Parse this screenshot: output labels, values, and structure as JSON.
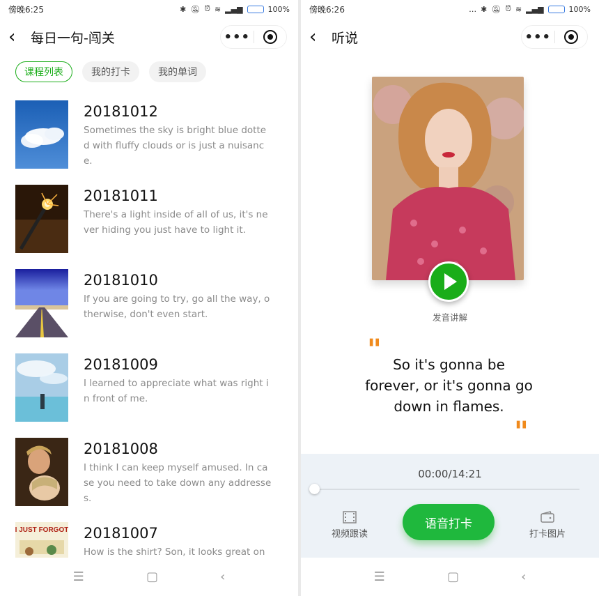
{
  "left": {
    "status": {
      "time": "傍晚6:25",
      "battery": "100%"
    },
    "nav": {
      "title": "每日一句-闯关"
    },
    "tabs": [
      {
        "label": "课程列表",
        "active": true
      },
      {
        "label": "我的打卡",
        "active": false
      },
      {
        "label": "我的单词",
        "active": false
      }
    ],
    "lessons": [
      {
        "date": "20181012",
        "text": "Sometimes the sky is bright blue dotted with fluffy clouds or is just a nuisance."
      },
      {
        "date": "20181011",
        "text": "There's a light inside of all of us, it's never hiding you just have to light it."
      },
      {
        "date": "20181010",
        "text": "If you are going to try, go all the way, otherwise, don't even start."
      },
      {
        "date": "20181009",
        "text": "I learned to appreciate what was right in front of me."
      },
      {
        "date": "20181008",
        "text": "I think I can keep myself amused. In case you need to take down any addresses."
      },
      {
        "date": "20181007",
        "text": "How is the shirt? Son, it looks great on you."
      }
    ],
    "thumb_7_caption": "I JUST FORGOT"
  },
  "right": {
    "status": {
      "time": "傍晚6:26",
      "battery": "100%"
    },
    "nav": {
      "title": "听说"
    },
    "play_label": "发音讲解",
    "quote": "So it's gonna be forever, or it's gonna go down in flames.",
    "player": {
      "time": "00:00/14:21",
      "progress": 0
    },
    "actions": {
      "video_label": "视频跟读",
      "checkin_label": "语音打卡",
      "photo_label": "打卡图片"
    }
  },
  "colors": {
    "accent": "#1aad19",
    "quote": "#f08a1c"
  }
}
